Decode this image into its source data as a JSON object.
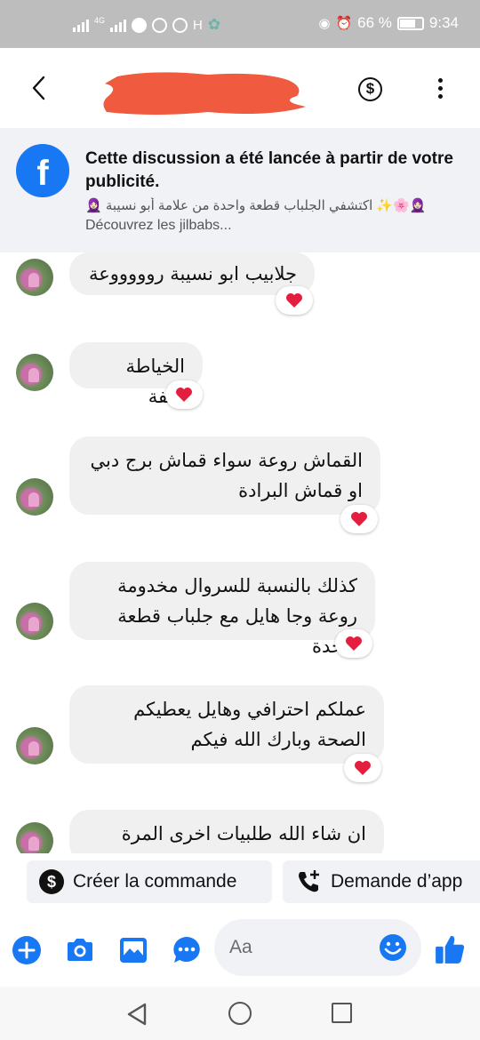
{
  "status_bar": {
    "network_badge": "4G",
    "carrier_letter": "H",
    "battery": "66 %",
    "time": "9:34",
    "battery_level": 0.66
  },
  "header": {
    "contact_name_redacted": true,
    "actions": [
      "back-icon",
      "dollar-icon",
      "more-icon"
    ]
  },
  "ad_banner": {
    "title": "Cette discussion a été lancée à partir de votre publicité.",
    "ad_text": "🧕🏻🌸✨ اكتشفي الجلباب قطعة واحدة من علامة أبو نسيبة 🧕🏻",
    "ad_text_fr": "Découvrez les jilbabs..."
  },
  "messages": [
    {
      "text": "جلابيب ابو نسيبة روووووعة",
      "reaction": "❤"
    },
    {
      "text": "الخياطة تحفة",
      "reaction": "❤"
    },
    {
      "text": "القماش روعة سواء قماش برج دبي او قماش البرادة",
      "reaction": "❤"
    },
    {
      "text": "كذلك بالنسبة للسروال مخدومة روعة وجا هايل مع جلباب قطعة واحدة",
      "reaction": "❤"
    },
    {
      "text": "عملكم احترافي وهايل يعطيكم الصحة وبارك الله فيكم",
      "reaction": "❤"
    },
    {
      "text": "ان شاء الله طلبيات اخرى المرة المقبلة",
      "reaction": ""
    }
  ],
  "quick_replies": [
    {
      "label": "Créer la commande",
      "icon": "dollar-circle-icon"
    },
    {
      "label": "Demande d’app",
      "icon": "phone-plus-icon"
    }
  ],
  "composer": {
    "placeholder": "Aa",
    "buttons": [
      "plus-icon",
      "camera-icon",
      "gallery-icon",
      "chat-dots-icon",
      "emoji-icon",
      "thumbs-up-icon"
    ]
  },
  "colors": {
    "accent": "#1877f2",
    "bubble": "#f0f0f0",
    "heart": "#e41e3f",
    "banner": "#f0f2f5"
  }
}
